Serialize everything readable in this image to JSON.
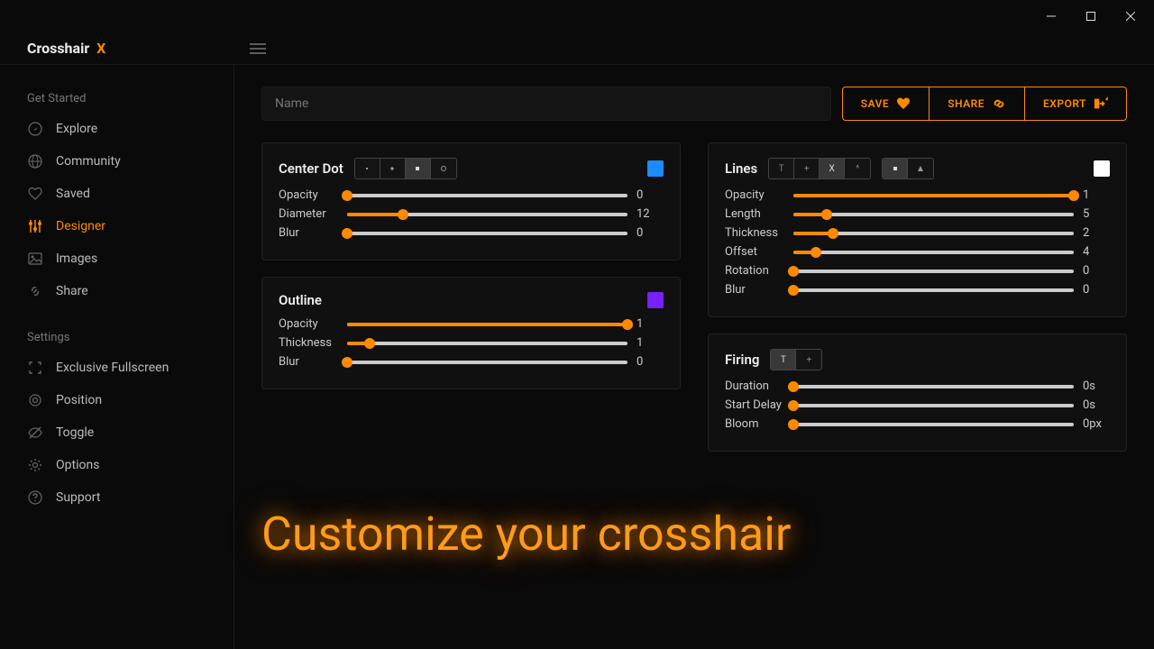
{
  "app": {
    "brand_prefix": "Crossh",
    "brand_mid": "air",
    "brand_x": "X"
  },
  "toolbar": {
    "name_placeholder": "Name",
    "save_label": "SAVE",
    "share_label": "SHARE",
    "export_label": "EXPORT"
  },
  "sidebar": {
    "section1_title": "Get Started",
    "items1": [
      {
        "label": "Explore"
      },
      {
        "label": "Community"
      },
      {
        "label": "Saved"
      },
      {
        "label": "Designer"
      },
      {
        "label": "Images"
      },
      {
        "label": "Share"
      }
    ],
    "section2_title": "Settings",
    "items2": [
      {
        "label": "Exclusive Fullscreen"
      },
      {
        "label": "Position"
      },
      {
        "label": "Toggle"
      },
      {
        "label": "Options"
      },
      {
        "label": "Support"
      }
    ]
  },
  "panels": {
    "centerdot": {
      "title": "Center Dot",
      "color": "#1a8cff",
      "sliders": [
        {
          "label": "Opacity",
          "value": "0",
          "pct": 0
        },
        {
          "label": "Diameter",
          "value": "12",
          "pct": 20
        },
        {
          "label": "Blur",
          "value": "0",
          "pct": 0
        }
      ]
    },
    "outline": {
      "title": "Outline",
      "color": "#7b1fff",
      "sliders": [
        {
          "label": "Opacity",
          "value": "1",
          "pct": 100
        },
        {
          "label": "Thickness",
          "value": "1",
          "pct": 8
        },
        {
          "label": "Blur",
          "value": "0",
          "pct": 0
        }
      ]
    },
    "lines": {
      "title": "Lines",
      "color": "#ffffff",
      "sliders": [
        {
          "label": "Opacity",
          "value": "1",
          "pct": 100
        },
        {
          "label": "Length",
          "value": "5",
          "pct": 12
        },
        {
          "label": "Thickness",
          "value": "2",
          "pct": 14
        },
        {
          "label": "Offset",
          "value": "4",
          "pct": 8
        },
        {
          "label": "Rotation",
          "value": "0",
          "pct": 0
        },
        {
          "label": "Blur",
          "value": "0",
          "pct": 0
        }
      ]
    },
    "firing": {
      "title": "Firing",
      "sliders": [
        {
          "label": "Duration",
          "value": "0s",
          "pct": 0
        },
        {
          "label": "Start Delay",
          "value": "0s",
          "pct": 0
        },
        {
          "label": "Bloom",
          "value": "0px",
          "pct": 0
        }
      ]
    }
  },
  "headline": "Customize your crosshair"
}
